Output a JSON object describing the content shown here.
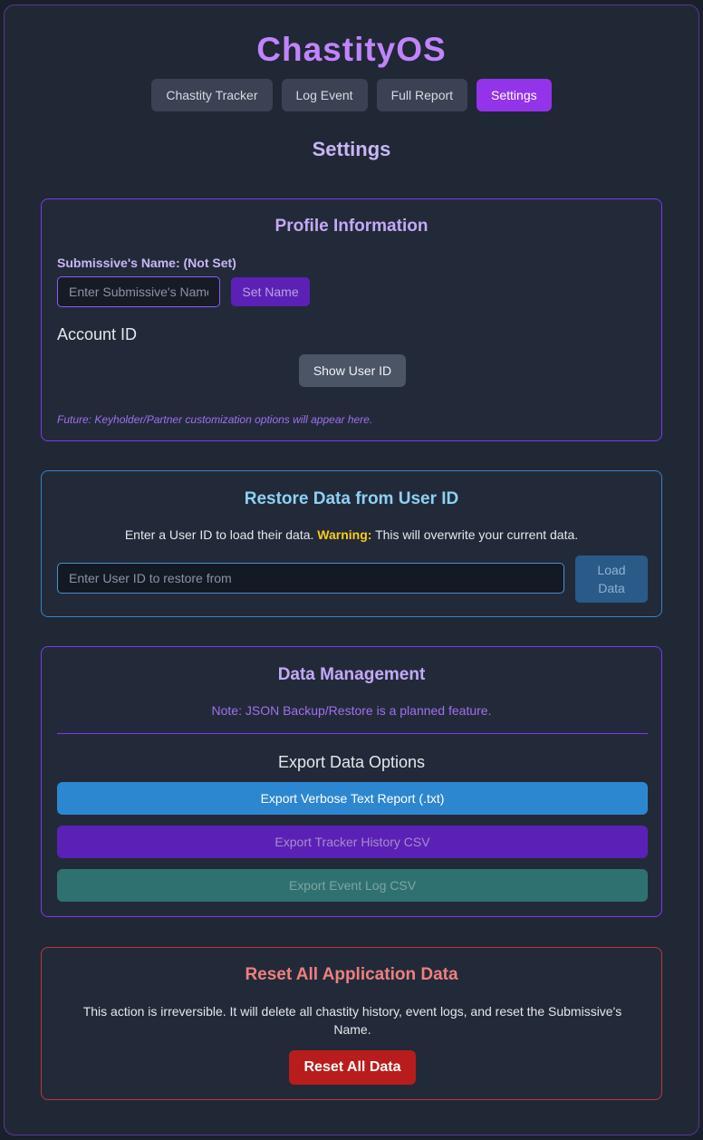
{
  "app": {
    "title": "ChastityOS"
  },
  "nav": {
    "tabs": [
      {
        "label": "Chastity Tracker"
      },
      {
        "label": "Log Event"
      },
      {
        "label": "Full Report"
      },
      {
        "label": "Settings"
      }
    ],
    "active_tab": "Settings"
  },
  "page": {
    "title": "Settings"
  },
  "profile": {
    "heading": "Profile Information",
    "name_label": "Submissive's Name: (Not Set)",
    "name_input_placeholder": "Enter Submissive's Name",
    "name_input_value": "",
    "set_name_label": "Set Name",
    "account_heading": "Account ID",
    "show_id_label": "Show User ID",
    "future_note": "Future: Keyholder/Partner customization options will appear here."
  },
  "restore": {
    "heading": "Restore Data from User ID",
    "desc_prefix": "Enter a User ID to load their data.",
    "desc_warning": "Warning:",
    "desc_suffix": "This will overwrite your current data.",
    "input_placeholder": "Enter User ID to restore from",
    "input_value": "",
    "load_label_line1": "Load",
    "load_label_line2": "Data"
  },
  "data_management": {
    "heading": "Data Management",
    "note": "Note: JSON Backup/Restore is a planned feature.",
    "export_heading": "Export Data Options",
    "export_txt_label": "Export Verbose Text Report (.txt)",
    "export_tracker_label": "Export Tracker History CSV",
    "export_event_label": "Export Event Log CSV"
  },
  "reset": {
    "heading": "Reset All Application Data",
    "description": "This action is irreversible. It will delete all chastity history, event logs, and reset the Submissive's Name.",
    "button_label": "Reset All Data"
  },
  "colors": {
    "accent_purple": "#9333ea",
    "title_purple": "#c084fc",
    "info_blue": "#2d87d0",
    "danger_red": "#b91c1c",
    "warning_yellow": "#facc15"
  }
}
